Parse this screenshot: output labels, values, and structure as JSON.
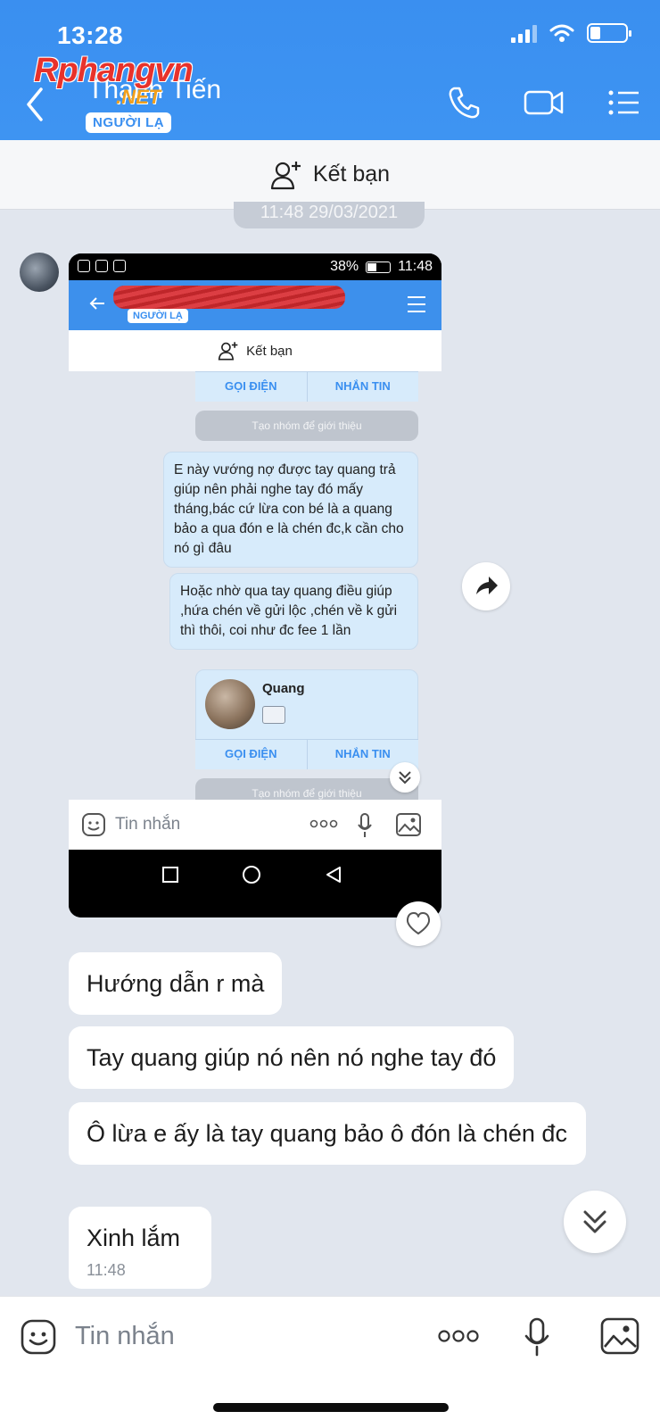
{
  "status_bar": {
    "time": "13:28"
  },
  "watermark": {
    "main": "Rphangvn",
    "sub": ".NET"
  },
  "header": {
    "contact_name": "Thanh Tiến",
    "badge": "NGƯỜI LẠ",
    "icons": [
      "back-icon",
      "phone-icon",
      "video-icon",
      "menu-icon"
    ]
  },
  "add_friend": {
    "label": "Kết bạn",
    "icon": "add-friend-icon"
  },
  "date_separator": "11:48 29/03/2021",
  "embedded_screenshot": {
    "status": {
      "battery": "38%",
      "time": "11:48"
    },
    "badge": "NGƯỜI LẠ",
    "add_friend": "Kết bạn",
    "call_label": "GỌI ĐIỆN",
    "message_label": "NHẮN TIN",
    "group_intro": "Tạo nhóm để giới thiệu",
    "messages": [
      "E này vướng nợ được tay quang trả giúp nên phải nghe tay đó mấy tháng,bác cứ lừa con bé là a quang bảo a qua đón e là chén đc,k cần cho nó gì đâu",
      "Hoặc nhờ qua tay quang điều giúp ,hứa chén về gửi lộc ,chén về k gửi thì thôi, coi như đc fee 1 lần"
    ],
    "contact_card": {
      "name": "Quang"
    },
    "input_placeholder": "Tin nhắn"
  },
  "messages": [
    {
      "text": "Hướng dẫn r mà"
    },
    {
      "text": "Tay quang giúp nó nên nó nghe tay đó"
    },
    {
      "text": "Ô lừa e ấy là tay quang bảo ô đón là chén đc"
    },
    {
      "text": "Xinh lắm",
      "time": "11:48"
    }
  ],
  "input": {
    "placeholder": "Tin nhắn"
  },
  "colors": {
    "header_blue": "#3a8ff0",
    "chat_bg": "#e1e6ee",
    "bubble": "#ffffff",
    "stranger_badge_text": "#3a8ff0"
  }
}
